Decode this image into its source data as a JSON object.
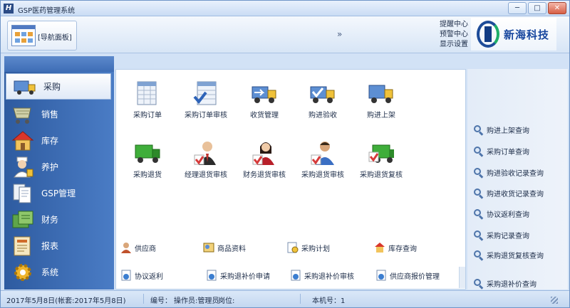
{
  "window": {
    "title": "GSP医药管理系统",
    "app_icon": "H"
  },
  "ribbon": {
    "nav_tab_label": "[导航面板]",
    "collapse_glyph": "»",
    "tools": [
      "提醒中心",
      "预警中心",
      "显示设置"
    ],
    "logo_text": "新海科技"
  },
  "sidebar": {
    "items": [
      {
        "label": "采购",
        "icon": "truck-icon",
        "active": true
      },
      {
        "label": "销售",
        "icon": "cart-icon",
        "active": false
      },
      {
        "label": "库存",
        "icon": "house-icon",
        "active": false
      },
      {
        "label": "养护",
        "icon": "nurse-icon",
        "active": false
      },
      {
        "label": "GSP管理",
        "icon": "documents-icon",
        "active": false
      },
      {
        "label": "财务",
        "icon": "finance-icon",
        "active": false
      },
      {
        "label": "报表",
        "icon": "report-icon",
        "active": false
      },
      {
        "label": "系统",
        "icon": "gear-icon",
        "active": false
      }
    ]
  },
  "main": {
    "row1": [
      {
        "label": "采购订单",
        "icon": "order-sheet-icon"
      },
      {
        "label": "采购订单审核",
        "icon": "order-audit-icon"
      },
      {
        "label": "收货管理",
        "icon": "receiving-icon"
      },
      {
        "label": "购进验收",
        "icon": "inspection-icon"
      },
      {
        "label": "购进上架",
        "icon": "shelving-truck-icon"
      }
    ],
    "row2": [
      {
        "label": "采购退货",
        "icon": "return-truck-icon"
      },
      {
        "label": "经理退货审核",
        "icon": "manager-icon"
      },
      {
        "label": "财务退货审核",
        "icon": "finance-woman-icon"
      },
      {
        "label": "采购退货审核",
        "icon": "buyer-icon"
      },
      {
        "label": "采购退货复核",
        "icon": "return-review-icon"
      }
    ],
    "links_row1": [
      {
        "label": "供应商",
        "icon": "supplier-icon"
      },
      {
        "label": "商品资料",
        "icon": "goods-icon"
      },
      {
        "label": "采购计划",
        "icon": "plan-icon"
      },
      {
        "label": "库存查询",
        "icon": "stock-query-icon"
      }
    ],
    "links_row2": [
      {
        "label": "协议返利",
        "icon": "rebate-icon"
      },
      {
        "label": "采购退补价申请",
        "icon": "price-apply-icon"
      },
      {
        "label": "采购退补价审核",
        "icon": "price-audit-icon"
      },
      {
        "label": "供应商报价管理",
        "icon": "quote-icon"
      }
    ]
  },
  "right_panel": {
    "queries": [
      "购进上架查询",
      "采购订单查询",
      "购进验收记录查询",
      "购进收货记录查询",
      "协议返利查询",
      "采购记录查询",
      "采购退货复核查询",
      "采购退补价查询"
    ]
  },
  "status": {
    "date": "2017年5月8日(帐套:2017年5月8日)",
    "code": "编号：",
    "operator": "操作员:管理员",
    "post": "岗位:",
    "machine": "本机号：1"
  },
  "colors": {
    "accent": "#2e5ba0",
    "brand": "#17469e",
    "check": "#d63a3a"
  }
}
